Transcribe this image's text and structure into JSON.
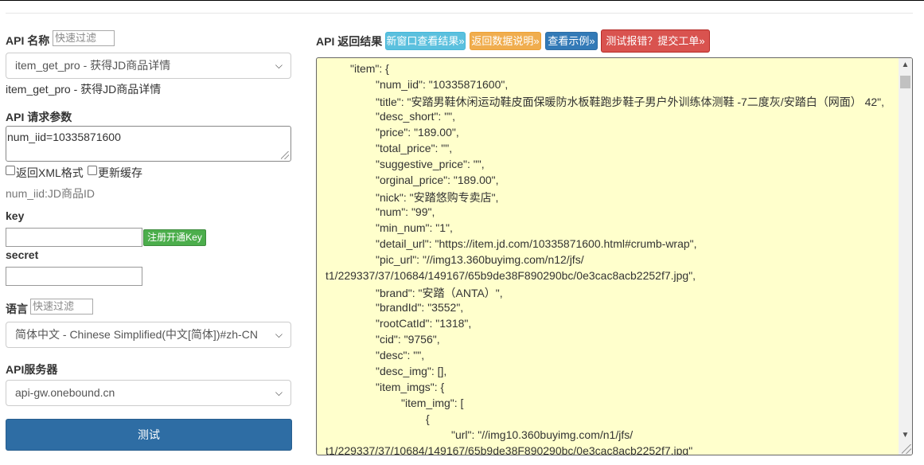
{
  "left": {
    "api_name_label": "API 名称",
    "filter_placeholder": "快速过滤",
    "api_select_value": "item_get_pro - 获得JD商品详情",
    "api_description": "item_get_pro - 获得JD商品详情",
    "params_label": "API 请求参数",
    "params_value": "num_iid=10335871600",
    "xml_checkbox_label": "返回XML格式",
    "cache_checkbox_label": "更新缓存",
    "param_hint": "num_iid:JD商品ID",
    "key_label": "key",
    "register_button": "注册开通Key",
    "secret_label": "secret",
    "lang_label": "语言",
    "lang_select_value": "简体中文 - Chinese Simplified(中文[简体])#zh-CN",
    "server_label": "API服务器",
    "server_select_value": "api-gw.onebound.cn",
    "test_button": "测试"
  },
  "right": {
    "result_label": "API 返回结果",
    "buttons": [
      {
        "label": "新窗口查看结果»",
        "color": "#5bc0de"
      },
      {
        "label": "返回数据说明»",
        "color": "#f0ad4e"
      },
      {
        "label": "查看示例»",
        "color": "#337ab7"
      },
      {
        "label": "测试报错？提交工单»",
        "color": "#d9534f"
      }
    ],
    "code_lines": [
      "\"item\": {",
      "\"num_iid\": \"10335871600\",",
      "\"title\": \"安踏男鞋休闲运动鞋皮面保暖防水板鞋跑步鞋子男户外训练体测鞋 -7二度灰/安踏白（网面） 42\",",
      "\"desc_short\": \"\",",
      "\"price\": \"189.00\",",
      "\"total_price\": \"\",",
      "\"suggestive_price\": \"\",",
      "\"orginal_price\": \"189.00\",",
      "\"nick\": \"安踏悠购专卖店\",",
      "\"num\": \"99\",",
      "\"min_num\": \"1\",",
      "\"detail_url\": \"https://item.jd.com/10335871600.html#crumb-wrap\",",
      "\"pic_url\": \"//img13.360buyimg.com/n12/jfs/",
      "t1/229337/37/10684/149167/65b9de38F890290bc/0e3cac8acb2252f7.jpg\",",
      "\"brand\": \"安踏（ANTA）\",",
      "\"brandId\": \"3552\",",
      "\"rootCatId\": \"1318\",",
      "\"cid\": \"9756\",",
      "\"desc\": \"\",",
      "\"desc_img\": [],",
      "\"item_imgs\": {",
      "\"item_img\": [",
      "{",
      "\"url\": \"//img10.360buyimg.com/n1/jfs/",
      "t1/229337/37/10684/149167/65b9de38F890290bc/0e3cac8acb2252f7.jpg\""
    ]
  }
}
